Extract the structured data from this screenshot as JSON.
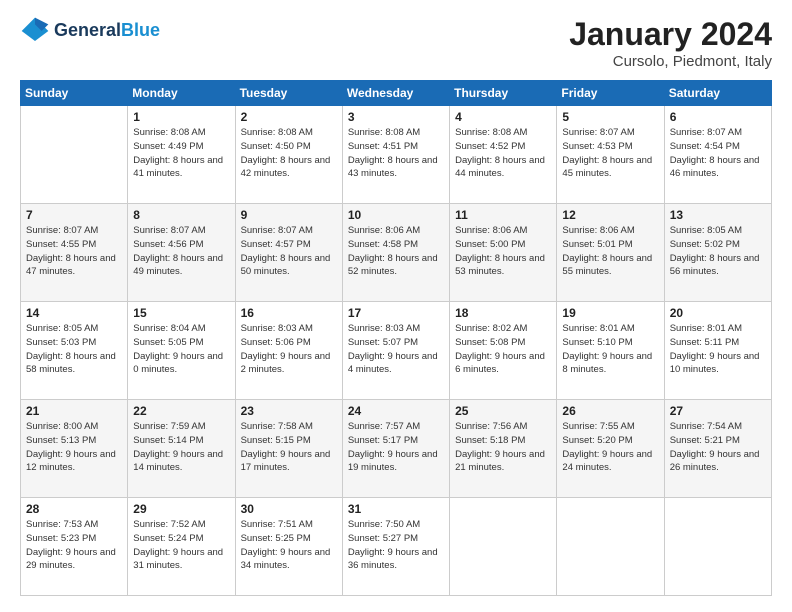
{
  "header": {
    "logo_line1": "General",
    "logo_line2": "Blue",
    "title": "January 2024",
    "subtitle": "Cursolo, Piedmont, Italy"
  },
  "days_of_week": [
    "Sunday",
    "Monday",
    "Tuesday",
    "Wednesday",
    "Thursday",
    "Friday",
    "Saturday"
  ],
  "weeks": [
    [
      {
        "day": "",
        "sunrise": "",
        "sunset": "",
        "daylight": ""
      },
      {
        "day": "1",
        "sunrise": "Sunrise: 8:08 AM",
        "sunset": "Sunset: 4:49 PM",
        "daylight": "Daylight: 8 hours and 41 minutes."
      },
      {
        "day": "2",
        "sunrise": "Sunrise: 8:08 AM",
        "sunset": "Sunset: 4:50 PM",
        "daylight": "Daylight: 8 hours and 42 minutes."
      },
      {
        "day": "3",
        "sunrise": "Sunrise: 8:08 AM",
        "sunset": "Sunset: 4:51 PM",
        "daylight": "Daylight: 8 hours and 43 minutes."
      },
      {
        "day": "4",
        "sunrise": "Sunrise: 8:08 AM",
        "sunset": "Sunset: 4:52 PM",
        "daylight": "Daylight: 8 hours and 44 minutes."
      },
      {
        "day": "5",
        "sunrise": "Sunrise: 8:07 AM",
        "sunset": "Sunset: 4:53 PM",
        "daylight": "Daylight: 8 hours and 45 minutes."
      },
      {
        "day": "6",
        "sunrise": "Sunrise: 8:07 AM",
        "sunset": "Sunset: 4:54 PM",
        "daylight": "Daylight: 8 hours and 46 minutes."
      }
    ],
    [
      {
        "day": "7",
        "sunrise": "Sunrise: 8:07 AM",
        "sunset": "Sunset: 4:55 PM",
        "daylight": "Daylight: 8 hours and 47 minutes."
      },
      {
        "day": "8",
        "sunrise": "Sunrise: 8:07 AM",
        "sunset": "Sunset: 4:56 PM",
        "daylight": "Daylight: 8 hours and 49 minutes."
      },
      {
        "day": "9",
        "sunrise": "Sunrise: 8:07 AM",
        "sunset": "Sunset: 4:57 PM",
        "daylight": "Daylight: 8 hours and 50 minutes."
      },
      {
        "day": "10",
        "sunrise": "Sunrise: 8:06 AM",
        "sunset": "Sunset: 4:58 PM",
        "daylight": "Daylight: 8 hours and 52 minutes."
      },
      {
        "day": "11",
        "sunrise": "Sunrise: 8:06 AM",
        "sunset": "Sunset: 5:00 PM",
        "daylight": "Daylight: 8 hours and 53 minutes."
      },
      {
        "day": "12",
        "sunrise": "Sunrise: 8:06 AM",
        "sunset": "Sunset: 5:01 PM",
        "daylight": "Daylight: 8 hours and 55 minutes."
      },
      {
        "day": "13",
        "sunrise": "Sunrise: 8:05 AM",
        "sunset": "Sunset: 5:02 PM",
        "daylight": "Daylight: 8 hours and 56 minutes."
      }
    ],
    [
      {
        "day": "14",
        "sunrise": "Sunrise: 8:05 AM",
        "sunset": "Sunset: 5:03 PM",
        "daylight": "Daylight: 8 hours and 58 minutes."
      },
      {
        "day": "15",
        "sunrise": "Sunrise: 8:04 AM",
        "sunset": "Sunset: 5:05 PM",
        "daylight": "Daylight: 9 hours and 0 minutes."
      },
      {
        "day": "16",
        "sunrise": "Sunrise: 8:03 AM",
        "sunset": "Sunset: 5:06 PM",
        "daylight": "Daylight: 9 hours and 2 minutes."
      },
      {
        "day": "17",
        "sunrise": "Sunrise: 8:03 AM",
        "sunset": "Sunset: 5:07 PM",
        "daylight": "Daylight: 9 hours and 4 minutes."
      },
      {
        "day": "18",
        "sunrise": "Sunrise: 8:02 AM",
        "sunset": "Sunset: 5:08 PM",
        "daylight": "Daylight: 9 hours and 6 minutes."
      },
      {
        "day": "19",
        "sunrise": "Sunrise: 8:01 AM",
        "sunset": "Sunset: 5:10 PM",
        "daylight": "Daylight: 9 hours and 8 minutes."
      },
      {
        "day": "20",
        "sunrise": "Sunrise: 8:01 AM",
        "sunset": "Sunset: 5:11 PM",
        "daylight": "Daylight: 9 hours and 10 minutes."
      }
    ],
    [
      {
        "day": "21",
        "sunrise": "Sunrise: 8:00 AM",
        "sunset": "Sunset: 5:13 PM",
        "daylight": "Daylight: 9 hours and 12 minutes."
      },
      {
        "day": "22",
        "sunrise": "Sunrise: 7:59 AM",
        "sunset": "Sunset: 5:14 PM",
        "daylight": "Daylight: 9 hours and 14 minutes."
      },
      {
        "day": "23",
        "sunrise": "Sunrise: 7:58 AM",
        "sunset": "Sunset: 5:15 PM",
        "daylight": "Daylight: 9 hours and 17 minutes."
      },
      {
        "day": "24",
        "sunrise": "Sunrise: 7:57 AM",
        "sunset": "Sunset: 5:17 PM",
        "daylight": "Daylight: 9 hours and 19 minutes."
      },
      {
        "day": "25",
        "sunrise": "Sunrise: 7:56 AM",
        "sunset": "Sunset: 5:18 PM",
        "daylight": "Daylight: 9 hours and 21 minutes."
      },
      {
        "day": "26",
        "sunrise": "Sunrise: 7:55 AM",
        "sunset": "Sunset: 5:20 PM",
        "daylight": "Daylight: 9 hours and 24 minutes."
      },
      {
        "day": "27",
        "sunrise": "Sunrise: 7:54 AM",
        "sunset": "Sunset: 5:21 PM",
        "daylight": "Daylight: 9 hours and 26 minutes."
      }
    ],
    [
      {
        "day": "28",
        "sunrise": "Sunrise: 7:53 AM",
        "sunset": "Sunset: 5:23 PM",
        "daylight": "Daylight: 9 hours and 29 minutes."
      },
      {
        "day": "29",
        "sunrise": "Sunrise: 7:52 AM",
        "sunset": "Sunset: 5:24 PM",
        "daylight": "Daylight: 9 hours and 31 minutes."
      },
      {
        "day": "30",
        "sunrise": "Sunrise: 7:51 AM",
        "sunset": "Sunset: 5:25 PM",
        "daylight": "Daylight: 9 hours and 34 minutes."
      },
      {
        "day": "31",
        "sunrise": "Sunrise: 7:50 AM",
        "sunset": "Sunset: 5:27 PM",
        "daylight": "Daylight: 9 hours and 36 minutes."
      },
      {
        "day": "",
        "sunrise": "",
        "sunset": "",
        "daylight": ""
      },
      {
        "day": "",
        "sunrise": "",
        "sunset": "",
        "daylight": ""
      },
      {
        "day": "",
        "sunrise": "",
        "sunset": "",
        "daylight": ""
      }
    ]
  ]
}
